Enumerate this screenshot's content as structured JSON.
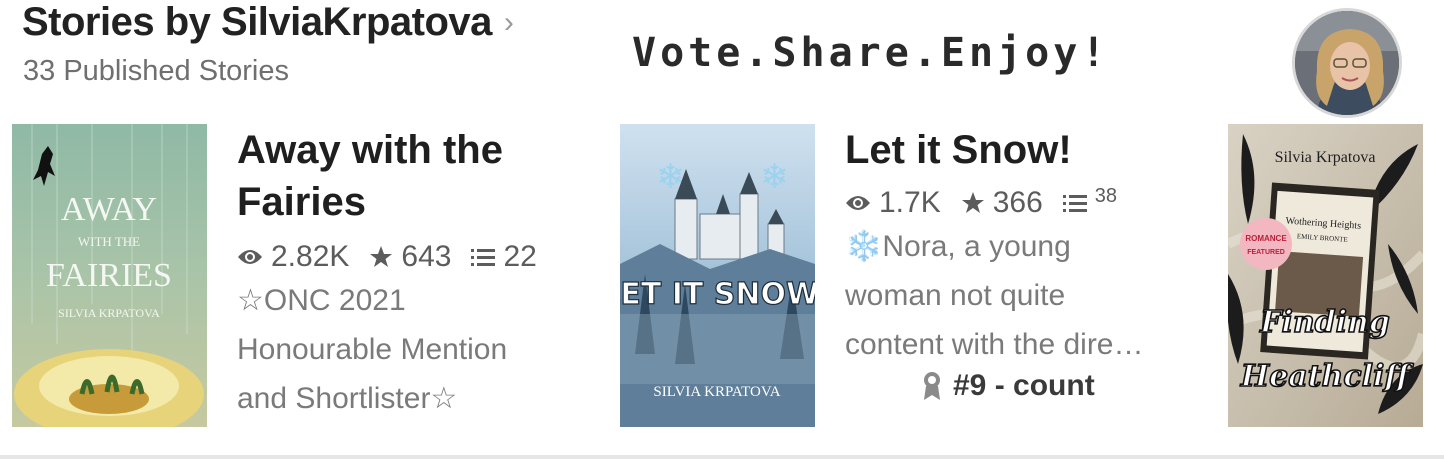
{
  "header": {
    "title": "Stories by SilviaKrpatova",
    "subtitle": "33 Published Stories",
    "tagline": "Vote.Share.Enjoy!"
  },
  "stories": [
    {
      "title_line1": "Away with the",
      "title_line2": "Fairies",
      "reads": "2.82K",
      "votes": "643",
      "parts": "22",
      "desc_lines": [
        "☆ONC 2021",
        "Honourable Mention",
        "and Shortlister☆"
      ],
      "cover": {
        "title_top": "AWAY",
        "title_mid": "WITH THE",
        "title_bottom": "FAIRIES",
        "author": "SILVIA KRPATOVA"
      }
    },
    {
      "title_line1": "Let it Snow!",
      "reads": "1.7K",
      "votes": "366",
      "parts": "38",
      "desc_lines": [
        "❄️Nora, a young",
        "woman not quite",
        "content with the dire…"
      ],
      "badge": "#9 - count",
      "cover": {
        "title": "LET IT SNOW!",
        "author": "SILVIA KRPATOVA"
      }
    },
    {
      "cover": {
        "author": "Silvia Krpatova",
        "book_title": "Wothering Heights",
        "book_author": "EMILY BRONTE",
        "sticker_line1": "ROMANCE",
        "sticker_line2": "FEATURED",
        "title_line1": "Finding",
        "title_line2": "Heathcliff"
      }
    }
  ],
  "colors": {
    "title": "#222222",
    "subtitle": "#6f6f6f",
    "stats": "#5c5c5c",
    "description": "#7a7a7a"
  }
}
